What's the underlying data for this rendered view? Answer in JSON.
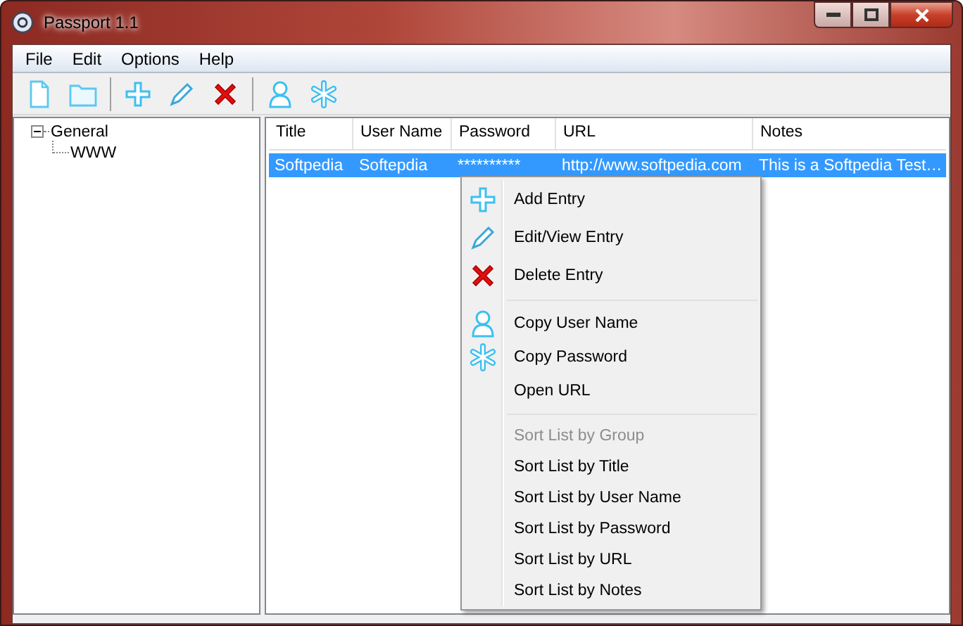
{
  "window": {
    "title": "Passport 1.1"
  },
  "menu_bar": [
    "File",
    "Edit",
    "Options",
    "Help"
  ],
  "tree": [
    {
      "label": "General",
      "expanded": true,
      "children": [
        {
          "label": "WWW"
        }
      ]
    }
  ],
  "table": {
    "columns": [
      "Title",
      "User Name",
      "Password",
      "URL",
      "Notes"
    ],
    "rows": [
      {
        "selected": true,
        "cells": [
          "Softpedia",
          "Softepdia",
          "**********",
          "http://www.softpedia.com",
          "This is a Softpedia Test…"
        ]
      }
    ]
  },
  "context_menu": {
    "groups": [
      [
        {
          "label": "Add Entry",
          "disabled": false
        },
        {
          "label": "Edit/View Entry",
          "disabled": false
        },
        {
          "label": "Delete Entry",
          "disabled": false
        }
      ],
      [
        {
          "label": "Copy User Name",
          "disabled": false
        },
        {
          "label": "Copy Password",
          "disabled": false
        },
        {
          "label": "Open URL",
          "disabled": false
        }
      ],
      [
        {
          "label": "Sort List by Group",
          "disabled": true
        },
        {
          "label": "Sort List by Title",
          "disabled": false
        },
        {
          "label": "Sort List by User Name",
          "disabled": false
        },
        {
          "label": "Sort List by Password",
          "disabled": false
        },
        {
          "label": "Sort List by URL",
          "disabled": false
        },
        {
          "label": "Sort List by Notes",
          "disabled": false
        }
      ]
    ]
  }
}
